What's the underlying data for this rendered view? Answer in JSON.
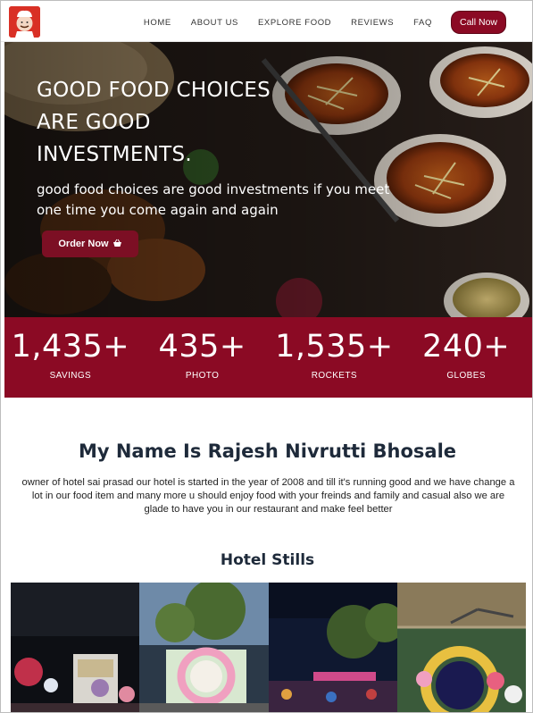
{
  "nav": {
    "links": [
      "HOME",
      "ABOUT US",
      "EXPLORE FOOD",
      "REVIEWS",
      "FAQ"
    ],
    "call_label": "Call Now"
  },
  "hero": {
    "title": "GOOD FOOD CHOICES ARE GOOD INVESTMENTS.",
    "subtitle": "good food choices are good investments if you meet one time you come again and again",
    "order_label": "Order Now",
    "order_icon": "basket-icon"
  },
  "stats": [
    {
      "value": "1,435+",
      "label": "SAVINGS"
    },
    {
      "value": "435+",
      "label": "PHOTO"
    },
    {
      "value": "1,535+",
      "label": "ROCKETS"
    },
    {
      "value": "240+",
      "label": "GLOBES"
    }
  ],
  "about": {
    "title": "My Name Is Rajesh Nivrutti Bhosale",
    "text": "owner of hotel sai prasad our hotel is started in the year of 2008 and till it's running good and we have change a lot in our food item and many more u should enjoy food with your freinds and family and casual also we are glade to have you in our restaurant and make feel better"
  },
  "stills": {
    "title": "Hotel Stills"
  },
  "colors": {
    "brand": "#8b0a24",
    "heading": "#1e2a3a"
  }
}
